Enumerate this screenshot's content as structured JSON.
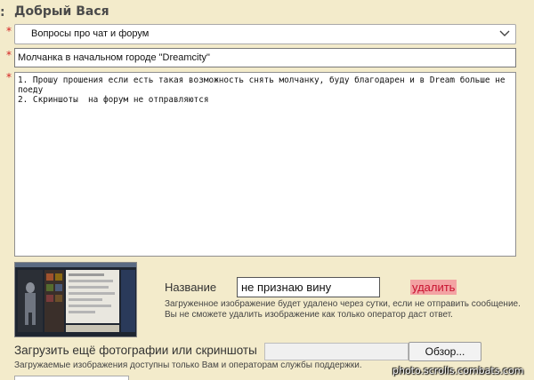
{
  "form": {
    "colon": ":",
    "greeting": "Добрый Вася",
    "required_mark": "*",
    "category": {
      "selected": "Вопросы про чат и форум",
      "chevron_icon": "chevron-down-icon"
    },
    "subject": {
      "value": "Молчанка в начальном городе \"Dreamcity\""
    },
    "message": {
      "value": "1. Прошу прошения если есть такая возможность снять молчанку, буду благодарен и в Dream больше не поеду\n2. Скриншоты  на форум не отправляются"
    }
  },
  "attachment": {
    "name_label": "Название",
    "name_value": "не признаю вину",
    "delete_label": "удалить",
    "note_line1": "Загруженное изображение будет удалено через сутки, если не отправить сообщение.",
    "note_line2": "Вы не сможете удалить изображение как только оператор даст ответ."
  },
  "upload": {
    "label": "Загрузить ещё фотографии или скриншоты",
    "browse_label": "Обзор...",
    "note": "Загружаемые изображения доступны только Вам и операторам службы поддержки."
  },
  "watermark": "photo.scrolls.combats.com",
  "colors": {
    "background": "#f3ebcb",
    "required": "#d42020",
    "delete_bg": "#f3a3a3",
    "delete_text": "#c8102e"
  }
}
